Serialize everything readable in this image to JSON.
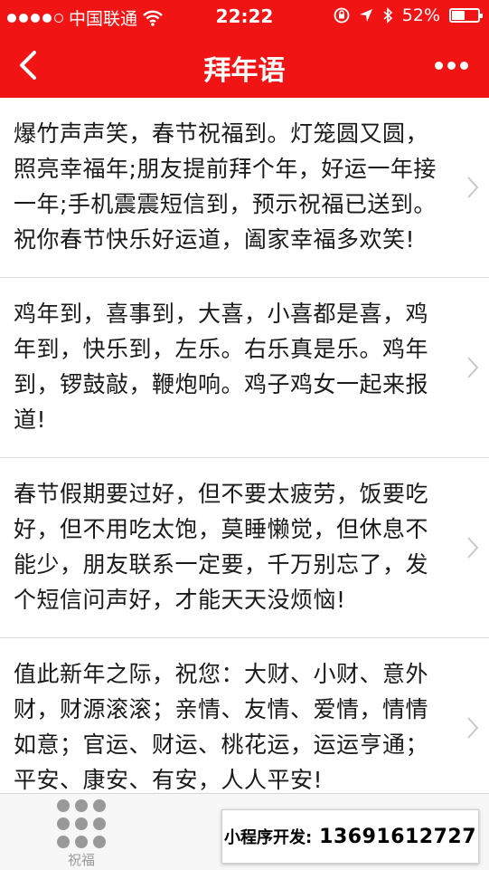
{
  "status_bar": {
    "carrier": "中国联通",
    "time": "22:22",
    "battery": "52%",
    "battery_level": 0.52,
    "signal_bars_filled": 4,
    "signal_bars_total": 5
  },
  "nav": {
    "title": "拜年语",
    "back_icon": "chevron-left-icon",
    "more_icon": "more-dots-icon"
  },
  "items": [
    {
      "text": "爆竹声声笑，春节祝福到。灯笼圆又圆，照亮幸福年;朋友提前拜个年，好运一年接一年;手机震震短信到，预示祝福已送到。祝你春节快乐好运道，阖家幸福多欢笑!"
    },
    {
      "text": "鸡年到，喜事到，大喜，小喜都是喜，鸡年到，快乐到，左乐。右乐真是乐。鸡年到，锣鼓敲，鞭炮响。鸡子鸡女一起来报道!"
    },
    {
      "text": "春节假期要过好，但不要太疲劳，饭要吃好，但不用吃太饱，莫睡懒觉，但休息不能少，朋友联系一定要，千万别忘了，发个短信问声好，才能天天没烦恼!"
    },
    {
      "text": "值此新年之际，祝您：大财、小财、意外财，财源滚滚；亲情、友情、爱情，情情如意；官运、财运、桃花运，运运亨通；平安、康安、有安，人人平安!"
    }
  ],
  "tabbar": {
    "tab_label": "祝福",
    "tab_icon": "grid-dots-icon"
  },
  "ad": {
    "label": "小程序开发:",
    "phone": "13691612727"
  },
  "colors": {
    "brand_red": "#f01414",
    "divider": "#dcdcdc",
    "tab_gray": "#999999"
  }
}
